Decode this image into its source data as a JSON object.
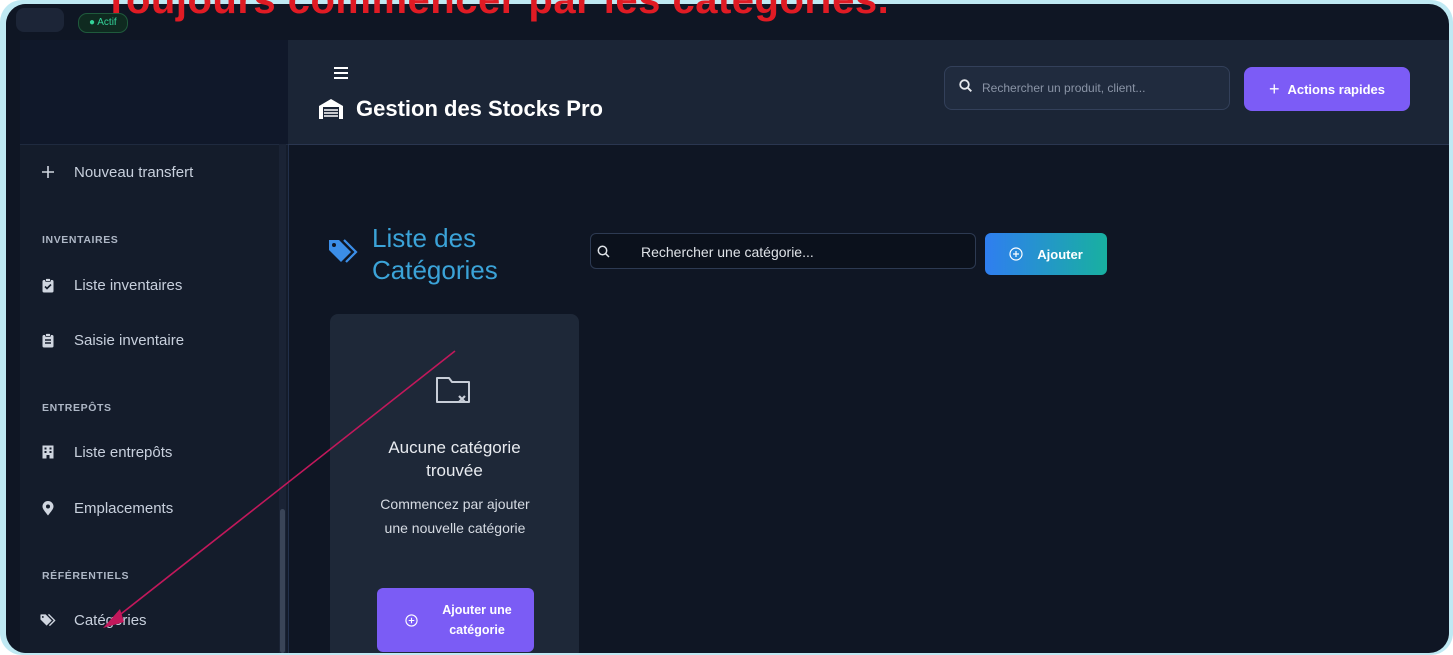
{
  "annotation": {
    "title": "Toujours commencer par les catégories."
  },
  "topbar": {
    "status_badge": "● Actif"
  },
  "sidebar": {
    "items_top": [
      {
        "label": "Nouveau transfert",
        "icon": "plus-icon"
      }
    ],
    "sections": [
      {
        "title": "INVENTAIRES",
        "items": [
          {
            "label": "Liste inventaires",
            "icon": "clipboard-check-icon"
          },
          {
            "label": "Saisie inventaire",
            "icon": "clipboard-list-icon"
          }
        ]
      },
      {
        "title": "ENTREPÔTS",
        "items": [
          {
            "label": "Liste entrepôts",
            "icon": "building-icon"
          },
          {
            "label": "Emplacements",
            "icon": "map-pin-icon"
          }
        ]
      },
      {
        "title": "RÉFÉRENTIELS",
        "items": [
          {
            "label": "Catégories",
            "icon": "tags-icon"
          }
        ]
      }
    ]
  },
  "header": {
    "title": "Gestion des Stocks Pro",
    "search_placeholder": "Rechercher un produit, client...",
    "quick_actions_label": "Actions rapides"
  },
  "main": {
    "heading": "Liste des Catégories",
    "search_placeholder": "Rechercher une catégorie...",
    "add_label": "Ajouter",
    "empty": {
      "title_line1": "Aucune catégorie",
      "title_line2": "trouvée",
      "description": "Commencez par ajouter une nouvelle catégorie",
      "button_line1": "Ajouter une",
      "button_line2": "catégorie"
    }
  },
  "colors": {
    "background": "#0f1624",
    "sidebar": "#141c2b",
    "header": "#1b2536",
    "accent_purple": "#7c5cf6",
    "heading_blue": "#3ba3d8",
    "annotation_red": "#e01b24",
    "arrow": "#c2185b",
    "frame_cyan": "#bfe9f3"
  }
}
